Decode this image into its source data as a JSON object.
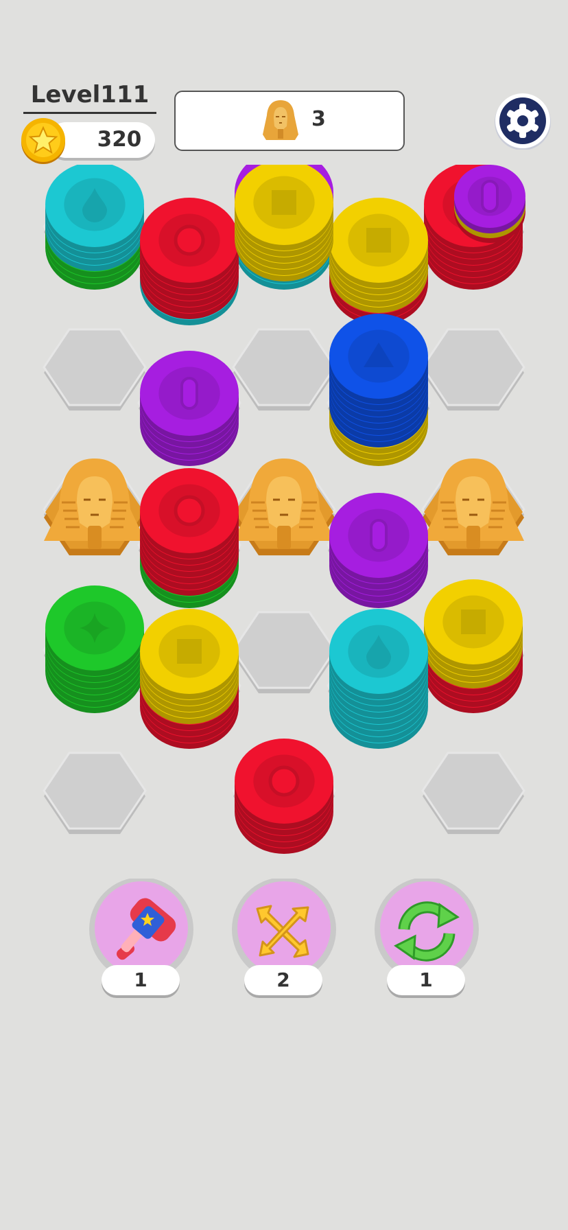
{
  "header": {
    "level_label": "Level111",
    "coins": "320",
    "goal": {
      "icon": "sphinx-icon",
      "count": "3"
    },
    "settings_icon": "gear-icon"
  },
  "colors": {
    "yellow": "#f2d000",
    "red": "#f0122e",
    "purple": "#a61ee0",
    "cyan": "#1cc8d2",
    "blue": "#0f52e8",
    "green": "#1ec82a",
    "tile": "#cfcfcf",
    "background": "#e0e0de",
    "gold": "#e6a532"
  },
  "boosters": [
    {
      "name": "hammer",
      "icon": "hammer-icon",
      "count": "1"
    },
    {
      "name": "swap",
      "icon": "cross-arrows-icon",
      "count": "2"
    },
    {
      "name": "shuffle",
      "icon": "refresh-icon",
      "count": "1"
    }
  ],
  "next_stack": {
    "colors": [
      "red",
      "yellow",
      "purple"
    ],
    "symbol": "oval"
  },
  "board": {
    "rows": 5,
    "columns": 5,
    "top_stack": {
      "column": 2,
      "colors": [
        "yellow",
        "yellow",
        "yellow",
        "yellow",
        "yellow",
        "yellow"
      ],
      "symbol": "square"
    },
    "cells": [
      {
        "row": 0,
        "column": 0,
        "content": "stack",
        "colors": [
          "green",
          "green",
          "green",
          "cyan",
          "cyan",
          "cyan",
          "cyan"
        ],
        "symbol": "drop"
      },
      {
        "row": 0,
        "column": 1,
        "content": "stack",
        "colors": [
          "cyan",
          "red",
          "red",
          "red",
          "red",
          "red",
          "red"
        ],
        "symbol": "circle"
      },
      {
        "row": 0,
        "column": 2,
        "content": "stack",
        "colors": [
          "cyan",
          "cyan",
          "purple",
          "purple",
          "purple",
          "purple",
          "purple",
          "purple",
          "purple"
        ],
        "symbol": "oval"
      },
      {
        "row": 0,
        "column": 3,
        "content": "stack",
        "colors": [
          "red",
          "red",
          "yellow",
          "yellow",
          "yellow",
          "yellow",
          "yellow"
        ],
        "symbol": "square"
      },
      {
        "row": 0,
        "column": 4,
        "content": "stack",
        "colors": [
          "red",
          "red",
          "red",
          "red",
          "red",
          "red",
          "red"
        ],
        "symbol": "circle"
      },
      {
        "row": 1,
        "column": 0,
        "content": "empty"
      },
      {
        "row": 1,
        "column": 1,
        "content": "stack",
        "colors": [
          "purple",
          "purple",
          "purple",
          "purple",
          "purple"
        ],
        "symbol": "oval"
      },
      {
        "row": 1,
        "column": 2,
        "content": "empty"
      },
      {
        "row": 1,
        "column": 3,
        "content": "stack",
        "colors": [
          "yellow",
          "yellow",
          "yellow",
          "blue",
          "blue",
          "blue",
          "blue",
          "blue",
          "blue",
          "blue",
          "blue"
        ],
        "symbol": "triangle"
      },
      {
        "row": 1,
        "column": 4,
        "content": "empty"
      },
      {
        "row": 2,
        "column": 0,
        "content": "sphinx"
      },
      {
        "row": 2,
        "column": 1,
        "content": "stack",
        "colors": [
          "green",
          "green",
          "red",
          "red",
          "red",
          "red",
          "red",
          "red",
          "red"
        ],
        "symbol": "circle"
      },
      {
        "row": 2,
        "column": 2,
        "content": "sphinx"
      },
      {
        "row": 2,
        "column": 3,
        "content": "stack",
        "colors": [
          "purple",
          "purple",
          "purple",
          "purple",
          "purple"
        ],
        "symbol": "oval"
      },
      {
        "row": 2,
        "column": 4,
        "content": "sphinx"
      },
      {
        "row": 3,
        "column": 0,
        "content": "stack",
        "colors": [
          "green",
          "green",
          "green",
          "green",
          "green",
          "green",
          "green"
        ],
        "symbol": "sparkle"
      },
      {
        "row": 3,
        "column": 1,
        "content": "stack",
        "colors": [
          "red",
          "red",
          "red",
          "red",
          "yellow",
          "yellow",
          "yellow",
          "yellow",
          "yellow"
        ],
        "symbol": "square"
      },
      {
        "row": 3,
        "column": 2,
        "content": "empty"
      },
      {
        "row": 3,
        "column": 3,
        "content": "stack",
        "colors": [
          "cyan",
          "cyan",
          "cyan",
          "cyan",
          "cyan",
          "cyan",
          "cyan",
          "cyan",
          "cyan"
        ],
        "symbol": "drop"
      },
      {
        "row": 3,
        "column": 4,
        "content": "stack",
        "colors": [
          "red",
          "red",
          "red",
          "red",
          "yellow",
          "yellow",
          "yellow",
          "yellow"
        ],
        "symbol": "square"
      },
      {
        "row": 4,
        "column": 0,
        "content": "empty"
      },
      {
        "row": 4,
        "column": 1,
        "content": "none"
      },
      {
        "row": 4,
        "column": 2,
        "content": "stack",
        "colors": [
          "red",
          "red",
          "red",
          "red",
          "red"
        ],
        "symbol": "circle"
      },
      {
        "row": 4,
        "column": 3,
        "content": "none"
      },
      {
        "row": 4,
        "column": 4,
        "content": "empty"
      }
    ]
  }
}
